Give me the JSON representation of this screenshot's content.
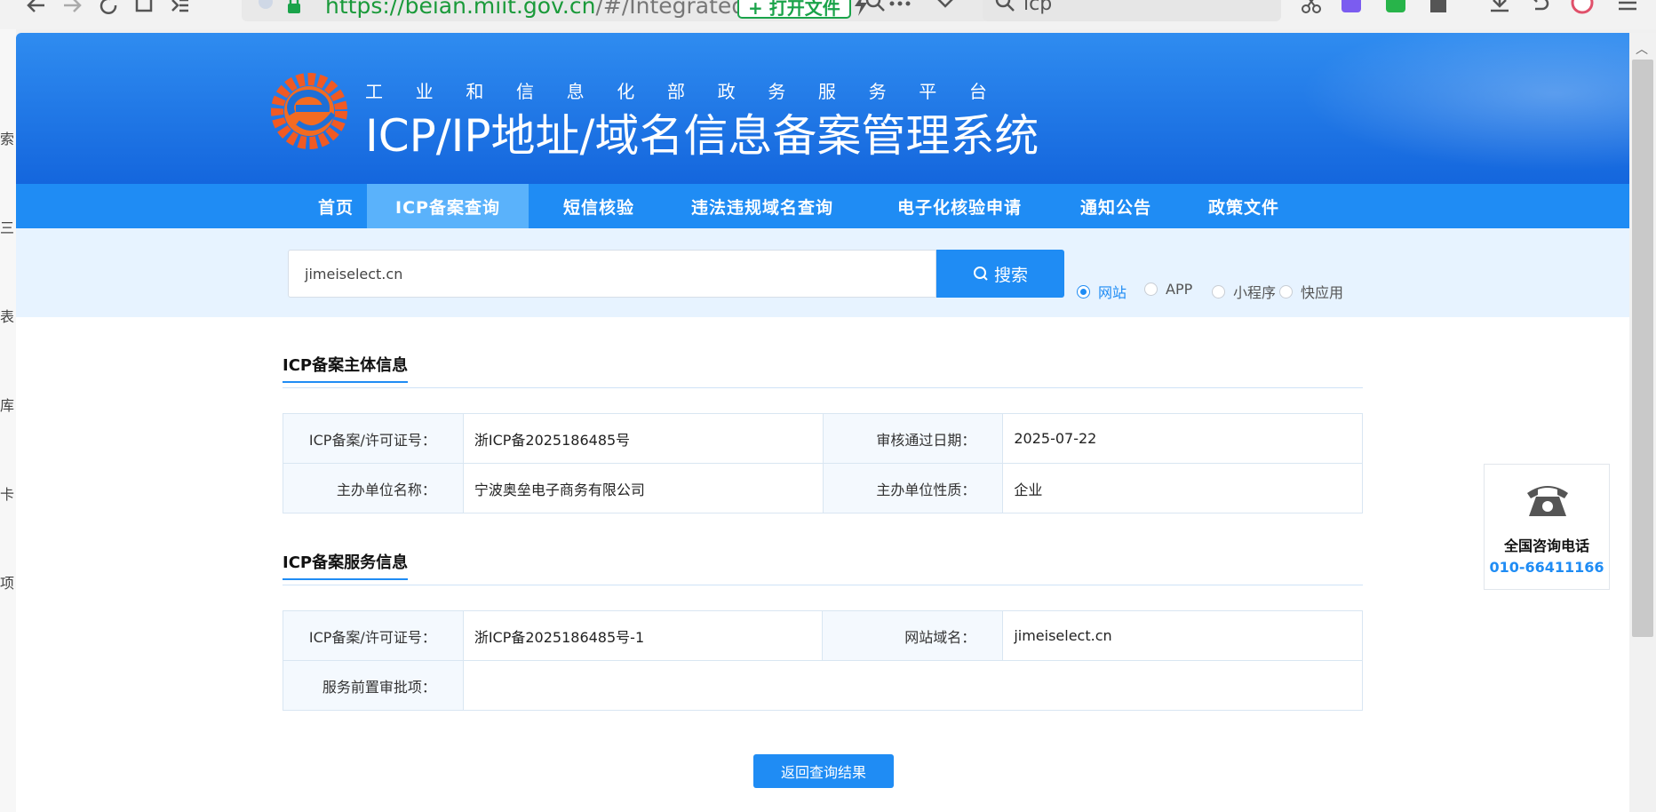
{
  "browser": {
    "url_host": "https://beian.miit.gov.cn",
    "url_rest": "/#/Integrated/re",
    "open_file_label": "+ 打开文件",
    "search_text": "icp"
  },
  "left_sliver": [
    "索",
    "三",
    "表",
    "库",
    "卡",
    "项"
  ],
  "header": {
    "subtitle_chars": [
      "工",
      "业",
      "和",
      "信",
      "息",
      "化",
      "部",
      "政",
      "务",
      "服",
      "务",
      "平",
      "台"
    ],
    "title": "ICP/IP地址/域名信息备案管理系统"
  },
  "nav": {
    "items": [
      {
        "label": "首页",
        "active": false
      },
      {
        "label": "ICP备案查询",
        "active": true
      },
      {
        "label": "短信核验",
        "active": false
      },
      {
        "label": "违法违规域名查询",
        "active": false
      },
      {
        "label": "电子化核验申请",
        "active": false
      },
      {
        "label": "通知公告",
        "active": false
      },
      {
        "label": "政策文件",
        "active": false
      }
    ]
  },
  "search": {
    "value": "jimeiselect.cn",
    "button_label": "搜索",
    "options": [
      {
        "label": "网站",
        "selected": true
      },
      {
        "label": "APP",
        "selected": false
      },
      {
        "label": "小程序",
        "selected": false
      },
      {
        "label": "快应用",
        "selected": false
      }
    ]
  },
  "subject": {
    "title": "ICP备案主体信息",
    "rows": [
      {
        "l1": "ICP备案/许可证号：",
        "v1": "浙ICP备2025186485号",
        "l2": "审核通过日期：",
        "v2": "2025-07-22"
      },
      {
        "l1": "主办单位名称：",
        "v1": "宁波奥垒电子商务有限公司",
        "l2": "主办单位性质：",
        "v2": "企业"
      }
    ]
  },
  "service": {
    "title": "ICP备案服务信息",
    "license_label": "ICP备案/许可证号：",
    "license_value": "浙ICP备2025186485号-1",
    "domain_label": "网站域名：",
    "domain_value": "jimeiselect.cn",
    "approval_label": "服务前置审批项：",
    "approval_value": ""
  },
  "return_label": "返回查询结果",
  "hotline": {
    "label": "全国咨询电话",
    "number": "010-66411166"
  }
}
